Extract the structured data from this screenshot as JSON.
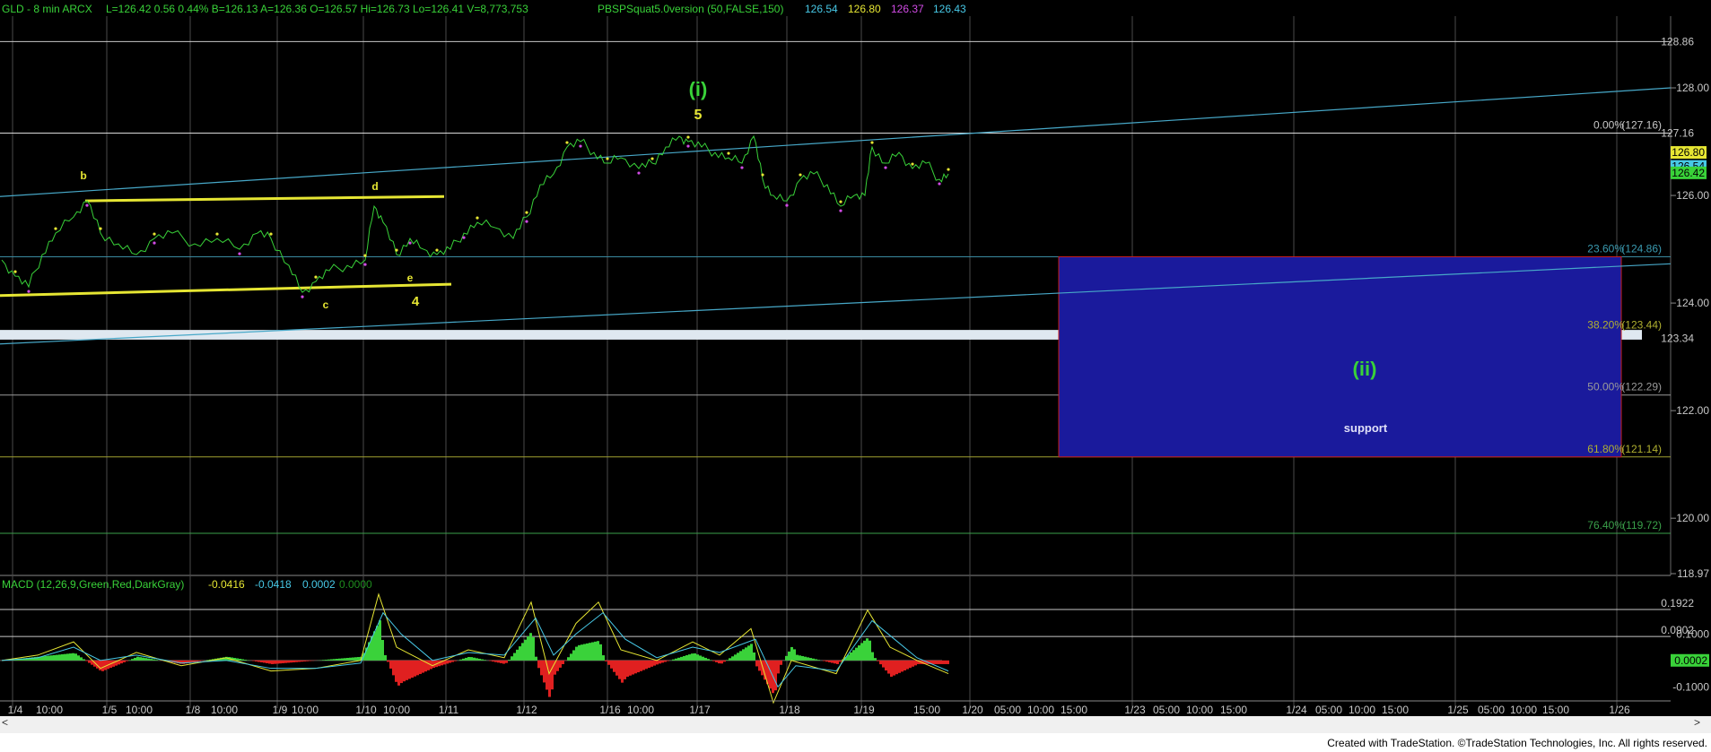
{
  "header": {
    "symbol": "GLD - 8 min  ARCX",
    "quote": "L=126.42  0.56  0.44%  B=126.13  A=126.36  O=126.57  Hi=126.73  Lo=126.41  V=8,773,753",
    "indicator": "PBSPSquat5.0version (50,FALSE,150)",
    "indicator_values": [
      "126.54",
      "126.80",
      "126.37",
      "126.43"
    ],
    "indicator_colors": [
      "#47c8e6",
      "#e6e633",
      "#d24be6",
      "#47c8e6"
    ]
  },
  "macd_header": {
    "label": "MACD (12,26,9,Green,Red,DarkGray)",
    "values": [
      "-0.0416",
      "-0.0418",
      "0.0002",
      "0.0000"
    ],
    "colors": [
      "#e6e633",
      "#47c8e6",
      "#47c8e6",
      "#1e8c1e"
    ]
  },
  "footer": {
    "text": "Created with TradeStation. ©TradeStation Technologies, Inc. All rights reserved."
  },
  "colors": {
    "price": "#39d239",
    "trend": "#47a8c8",
    "triangle": "#e6e633",
    "zone_fill": "#1a1a9c",
    "zone_border": "#c81e1e",
    "text_gray": "#c8c8c8"
  },
  "chart_data": [
    {
      "type": "line",
      "title": "",
      "xlabel": "",
      "ylabel": "",
      "ylim": [
        118.97,
        129.3
      ],
      "grid": true,
      "y_ticks": [
        "128.00",
        "126.00",
        "124.00",
        "122.00",
        "120.00",
        "118.97"
      ],
      "x_ticks": [
        "1/4",
        "10:00",
        "1/5",
        "10:00",
        "1/8",
        "10:00",
        "1/9",
        "10:00",
        "1/10",
        "10:00",
        "1/11",
        "1/12",
        "1/16",
        "10:00",
        "1/17",
        "1/18",
        "1/19",
        "15:00",
        "1/20",
        "05:00",
        "10:00",
        "15:00",
        "1/23",
        "05:00",
        "10:00",
        "15:00",
        "1/24",
        "05:00",
        "10:00",
        "15:00",
        "1/25",
        "05:00",
        "10:00",
        "15:00",
        "1/26"
      ],
      "price_labels": [
        "128.86",
        "127.16",
        "126.80",
        "126.54",
        "126.42",
        "123.34"
      ],
      "fib_levels": [
        {
          "label": "0.00%",
          "value": "127.16"
        },
        {
          "label": "23.60%",
          "value": "124.86"
        },
        {
          "label": "38.20%",
          "value": "123.44"
        },
        {
          "label": "50.00%",
          "value": "122.29"
        },
        {
          "label": "61.80%",
          "value": "121.14"
        },
        {
          "label": "76.40%",
          "value": "119.72"
        }
      ],
      "wave_labels": [
        "b",
        "d",
        "c",
        "e",
        "4",
        "(i)",
        "5",
        "(ii)"
      ],
      "zone_label": "support",
      "series": [
        {
          "values": [
            {
              "x": 0,
              "y": 124.8
            },
            {
              "x": 15,
              "y": 124.5
            },
            {
              "x": 30,
              "y": 124.3
            },
            {
              "x": 45,
              "y": 124.9
            },
            {
              "x": 60,
              "y": 125.3
            },
            {
              "x": 80,
              "y": 125.6
            },
            {
              "x": 95,
              "y": 125.9
            },
            {
              "x": 110,
              "y": 125.3
            },
            {
              "x": 130,
              "y": 125.1
            },
            {
              "x": 150,
              "y": 124.9
            },
            {
              "x": 170,
              "y": 125.2
            },
            {
              "x": 190,
              "y": 125.3
            },
            {
              "x": 215,
              "y": 125.1
            },
            {
              "x": 240,
              "y": 125.2
            },
            {
              "x": 265,
              "y": 125.0
            },
            {
              "x": 285,
              "y": 125.3
            },
            {
              "x": 300,
              "y": 125.2
            },
            {
              "x": 320,
              "y": 124.7
            },
            {
              "x": 335,
              "y": 124.2
            },
            {
              "x": 350,
              "y": 124.4
            },
            {
              "x": 365,
              "y": 124.6
            },
            {
              "x": 385,
              "y": 124.7
            },
            {
              "x": 405,
              "y": 124.8
            },
            {
              "x": 415,
              "y": 125.8
            },
            {
              "x": 425,
              "y": 125.5
            },
            {
              "x": 440,
              "y": 124.9
            },
            {
              "x": 455,
              "y": 125.2
            },
            {
              "x": 470,
              "y": 125.0
            },
            {
              "x": 485,
              "y": 124.9
            },
            {
              "x": 500,
              "y": 125.0
            },
            {
              "x": 515,
              "y": 125.3
            },
            {
              "x": 530,
              "y": 125.5
            },
            {
              "x": 550,
              "y": 125.4
            },
            {
              "x": 570,
              "y": 125.2
            },
            {
              "x": 585,
              "y": 125.6
            },
            {
              "x": 600,
              "y": 126.2
            },
            {
              "x": 615,
              "y": 126.4
            },
            {
              "x": 630,
              "y": 126.9
            },
            {
              "x": 645,
              "y": 127.0
            },
            {
              "x": 660,
              "y": 126.8
            },
            {
              "x": 675,
              "y": 126.6
            },
            {
              "x": 690,
              "y": 126.7
            },
            {
              "x": 710,
              "y": 126.5
            },
            {
              "x": 725,
              "y": 126.6
            },
            {
              "x": 740,
              "y": 126.9
            },
            {
              "x": 755,
              "y": 127.1
            },
            {
              "x": 765,
              "y": 127.0
            },
            {
              "x": 780,
              "y": 126.9
            },
            {
              "x": 795,
              "y": 126.8
            },
            {
              "x": 810,
              "y": 126.7
            },
            {
              "x": 825,
              "y": 126.6
            },
            {
              "x": 838,
              "y": 127.1
            },
            {
              "x": 848,
              "y": 126.3
            },
            {
              "x": 860,
              "y": 126.0
            },
            {
              "x": 875,
              "y": 125.9
            },
            {
              "x": 890,
              "y": 126.3
            },
            {
              "x": 905,
              "y": 126.4
            },
            {
              "x": 920,
              "y": 126.2
            },
            {
              "x": 935,
              "y": 125.8
            },
            {
              "x": 950,
              "y": 126.0
            },
            {
              "x": 962,
              "y": 126.0
            },
            {
              "x": 970,
              "y": 126.9
            },
            {
              "x": 985,
              "y": 126.6
            },
            {
              "x": 1000,
              "y": 126.8
            },
            {
              "x": 1015,
              "y": 126.5
            },
            {
              "x": 1030,
              "y": 126.6
            },
            {
              "x": 1045,
              "y": 126.3
            },
            {
              "x": 1055,
              "y": 126.4
            }
          ]
        }
      ]
    },
    {
      "type": "line",
      "title": "",
      "xlabel": "",
      "ylabel": "",
      "ylim": [
        -0.18,
        0.26
      ],
      "grid": true,
      "y_ticks": [
        "0.1000",
        "-0.1000"
      ],
      "price_labels": [
        "0.1922",
        "0.0902",
        "0.0002"
      ],
      "series": [
        {
          "values": [
            {
              "x": 0,
              "y": 0.0
            },
            {
              "x": 40,
              "y": 0.02
            },
            {
              "x": 80,
              "y": 0.07
            },
            {
              "x": 110,
              "y": -0.03
            },
            {
              "x": 150,
              "y": 0.03
            },
            {
              "x": 200,
              "y": -0.02
            },
            {
              "x": 250,
              "y": 0.01
            },
            {
              "x": 300,
              "y": -0.04
            },
            {
              "x": 350,
              "y": -0.03
            },
            {
              "x": 400,
              "y": 0.0
            },
            {
              "x": 420,
              "y": 0.25
            },
            {
              "x": 440,
              "y": 0.05
            },
            {
              "x": 480,
              "y": -0.02
            },
            {
              "x": 520,
              "y": 0.04
            },
            {
              "x": 560,
              "y": 0.01
            },
            {
              "x": 590,
              "y": 0.22
            },
            {
              "x": 610,
              "y": -0.05
            },
            {
              "x": 640,
              "y": 0.14
            },
            {
              "x": 665,
              "y": 0.22
            },
            {
              "x": 690,
              "y": 0.04
            },
            {
              "x": 730,
              "y": 0.0
            },
            {
              "x": 770,
              "y": 0.07
            },
            {
              "x": 800,
              "y": 0.02
            },
            {
              "x": 835,
              "y": 0.12
            },
            {
              "x": 860,
              "y": -0.16
            },
            {
              "x": 880,
              "y": 0.0
            },
            {
              "x": 930,
              "y": -0.05
            },
            {
              "x": 965,
              "y": 0.19
            },
            {
              "x": 990,
              "y": 0.05
            },
            {
              "x": 1020,
              "y": 0.0
            },
            {
              "x": 1055,
              "y": -0.05
            }
          ]
        },
        {
          "values": [
            {
              "x": 0,
              "y": 0.0
            },
            {
              "x": 40,
              "y": 0.01
            },
            {
              "x": 80,
              "y": 0.05
            },
            {
              "x": 110,
              "y": 0.0
            },
            {
              "x": 150,
              "y": 0.02
            },
            {
              "x": 200,
              "y": -0.01
            },
            {
              "x": 250,
              "y": 0.0
            },
            {
              "x": 300,
              "y": -0.03
            },
            {
              "x": 350,
              "y": -0.03
            },
            {
              "x": 400,
              "y": -0.01
            },
            {
              "x": 425,
              "y": 0.18
            },
            {
              "x": 445,
              "y": 0.1
            },
            {
              "x": 480,
              "y": 0.0
            },
            {
              "x": 520,
              "y": 0.03
            },
            {
              "x": 560,
              "y": 0.02
            },
            {
              "x": 595,
              "y": 0.16
            },
            {
              "x": 615,
              "y": 0.02
            },
            {
              "x": 640,
              "y": 0.1
            },
            {
              "x": 670,
              "y": 0.18
            },
            {
              "x": 695,
              "y": 0.08
            },
            {
              "x": 730,
              "y": 0.01
            },
            {
              "x": 770,
              "y": 0.05
            },
            {
              "x": 800,
              "y": 0.03
            },
            {
              "x": 840,
              "y": 0.08
            },
            {
              "x": 865,
              "y": -0.1
            },
            {
              "x": 885,
              "y": -0.02
            },
            {
              "x": 930,
              "y": -0.04
            },
            {
              "x": 970,
              "y": 0.15
            },
            {
              "x": 995,
              "y": 0.08
            },
            {
              "x": 1020,
              "y": 0.01
            },
            {
              "x": 1055,
              "y": -0.04
            }
          ]
        }
      ]
    }
  ]
}
